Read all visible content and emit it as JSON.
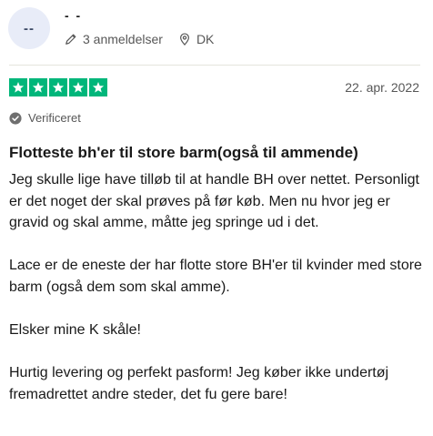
{
  "reviewer": {
    "avatar_initials": "--",
    "name": "- -",
    "review_count": "3 anmeldelser",
    "country": "DK"
  },
  "rating": {
    "stars": 5,
    "max": 5,
    "color": "#00b67a"
  },
  "review": {
    "date": "22. apr. 2022",
    "verified_label": "Verificeret",
    "title": "Flotteste bh'er til store barm(også til ammende)",
    "paragraphs": [
      "Jeg skulle lige have tilløb til at handle BH over nettet. Personligt er det noget der skal prøves på før køb. Men nu hvor jeg er gravid og skal amme, måtte jeg springe ud i det.",
      "Lace er de eneste der har flotte store BH'er til kvinder med store barm (også dem som skal amme).",
      "Elsker mine K skåle!",
      "Hurtig levering og perfekt pasform! Jeg køber ikke undertøj fremadrettet andre steder, det fu gere bare!"
    ]
  },
  "icons": {
    "review_count": "pencil-icon",
    "country": "location-pin-icon",
    "verified": "verified-check-icon",
    "star": "star-icon"
  }
}
